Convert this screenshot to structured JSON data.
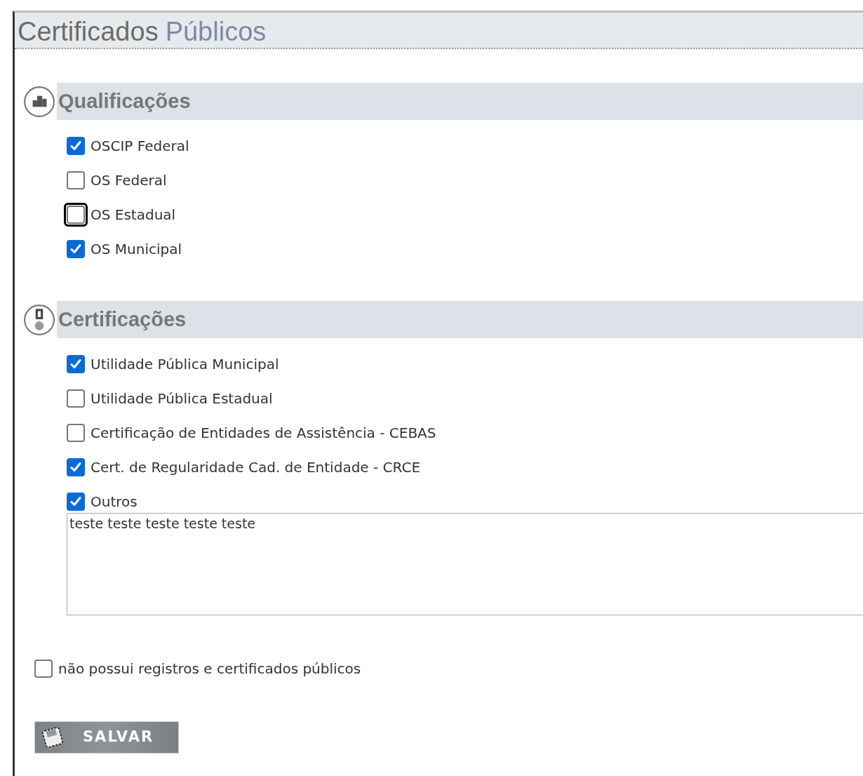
{
  "page_title": {
    "first_word": "Certificados",
    "second_word": "Públicos"
  },
  "sections": [
    {
      "kind": "podium",
      "title": "Qualificações",
      "options": [
        {
          "label": "OSCIP Federal",
          "checked": true,
          "focused": false
        },
        {
          "label": "OS Federal",
          "checked": false,
          "focused": false
        },
        {
          "label": "OS Estadual",
          "checked": false,
          "focused": true
        },
        {
          "label": "OS Municipal",
          "checked": true,
          "focused": false
        }
      ]
    },
    {
      "kind": "medal",
      "title": "Certificações",
      "options": [
        {
          "label": "Utilidade Pública Municipal",
          "checked": true,
          "focused": false
        },
        {
          "label": "Utilidade Pública Estadual",
          "checked": false,
          "focused": false
        },
        {
          "label": "Certificação de Entidades de Assistência - CEBAS",
          "checked": false,
          "focused": false
        },
        {
          "label": "Cert. de Regularidade Cad. de Entidade - CRCE",
          "checked": true,
          "focused": false
        },
        {
          "label": "Outros",
          "checked": true,
          "focused": false
        }
      ],
      "other_text": "teste teste teste teste teste"
    }
  ],
  "no_records": {
    "label": "não possui registros e certificados públicos",
    "checked": false
  },
  "save_button": {
    "label": "SALVAR"
  }
}
